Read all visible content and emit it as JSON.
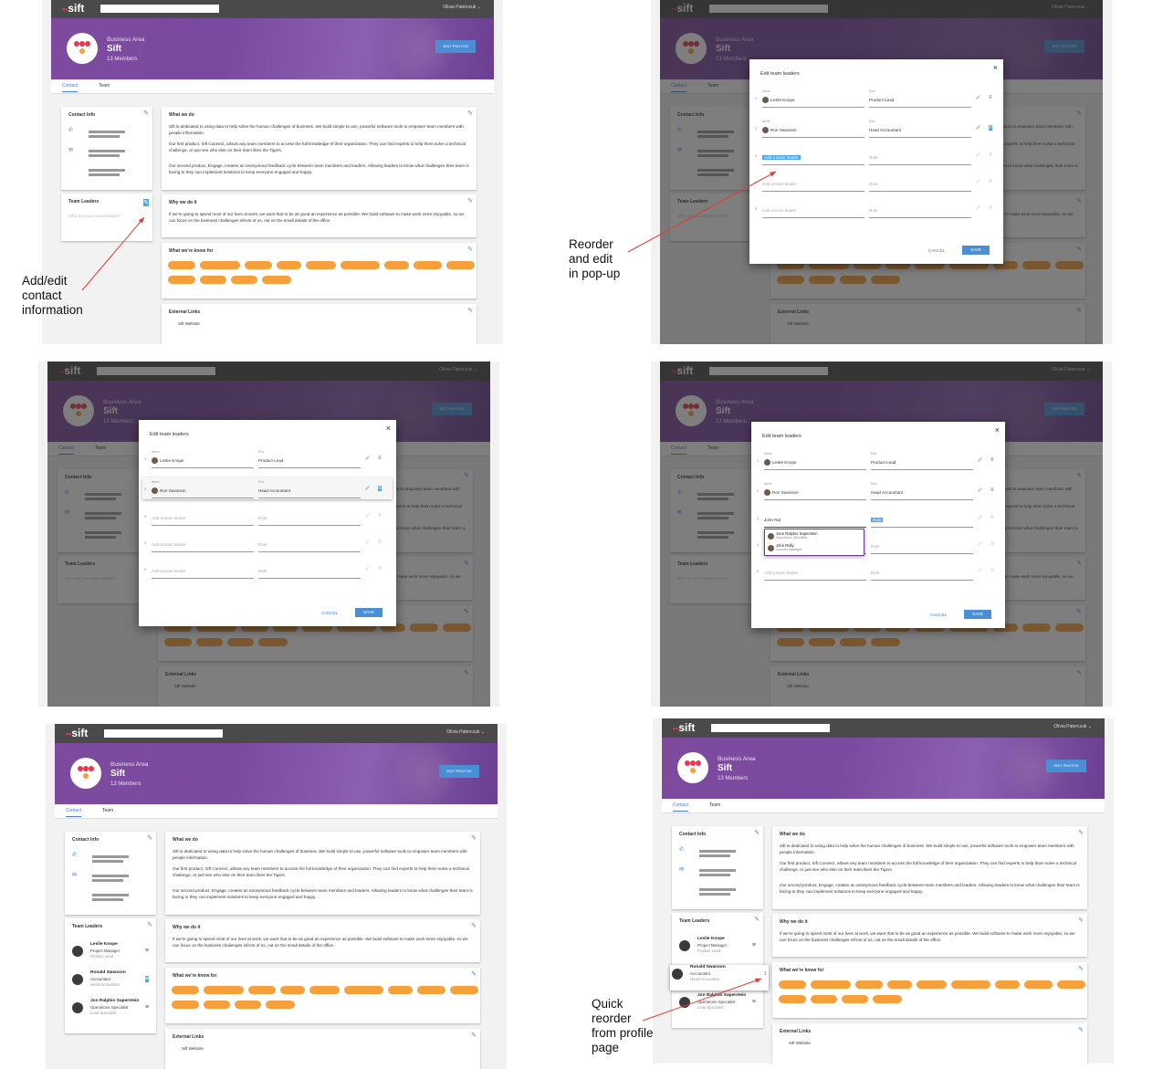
{
  "app": {
    "logo": "sift",
    "user_name": "Olivia Paterczuk",
    "business_area_label": "Business Area",
    "team_name": "Sift",
    "members": "13 Members",
    "edit_photos": "EDIT PHOTOS",
    "tabs": [
      "Contact",
      "Team"
    ]
  },
  "cards": {
    "contact_info": "Contact Info",
    "team_leaders": "Team Leaders",
    "team_leaders_placeholder": "Who are your team leaders?",
    "what_we_do": "What we do",
    "what_we_do_p1": "Sift is dedicated to using data to help solve the human challenges of business. We build simple to use, powerful software tools to empower team members with people information.",
    "what_we_do_p2": "Our first product, Sift Connect, allows any team members to access the full knowledge of their organization. They can find experts to help them solve a technical challenge, or just see who else on their team likes the Tigers.",
    "what_we_do_p3": "Our second product, Engage, creates an anonymous feedback cycle between team members and leaders. Allowing leaders to know what challenges their team is facing to they can implement solutions to keep everyone engaged and happy.",
    "why_we_do_it": "Why we do it",
    "why_we_do_it_text": "If we're going to spend most of our lives at work, we want that to be as good an experience as possible. We build software to make work more enjoyable, so we can focus on the business challenges infront of us, not on the small details of the office.",
    "known_for": "What we're know for",
    "external_links": "External Links",
    "sift_website": "Sift Website"
  },
  "modal": {
    "title": "Edit team leaders",
    "name_label": "Name",
    "role_label": "Role",
    "add_placeholder": "Add a team leader",
    "role_placeholder": "Role",
    "cancel": "CANCEL",
    "save": "SAVE",
    "leaders": [
      {
        "name": "Leslie Knope",
        "role": "Product Lead"
      },
      {
        "name": "Ron Swanson",
        "role": "Head Accountant"
      }
    ],
    "row_numbers": [
      "1",
      "2",
      "3",
      "4",
      "5"
    ],
    "typed": "John Ral",
    "suggestions": [
      {
        "name": "Jone Ralphio Saperstein",
        "role": "Operations Specialist"
      },
      {
        "name": "John Rally",
        "role": "Account Manager"
      }
    ]
  },
  "profile_leaders": [
    {
      "name": "Leslie Knope",
      "role": "Project Manager",
      "sub": "Product Lead"
    },
    {
      "name": "Ronald Swanson",
      "role": "Accountant",
      "sub": "Head Accountant"
    },
    {
      "name": "Jon Ralphio Saperstein",
      "role": "Operations Specialist",
      "sub": "Lead Specialist"
    }
  ],
  "annotations": {
    "add_edit": [
      "Add/edit",
      "contact",
      "information"
    ],
    "reorder": [
      "Reorder",
      "and edit",
      "in pop-up"
    ],
    "quick": [
      "Quick",
      "reorder",
      "from profile",
      "page"
    ]
  },
  "colors": {
    "accent": "#4a8fd4",
    "pill": "#f5a03a",
    "banner": "#7d4a9e",
    "topbar": "#4a4a4a",
    "arrow": "#e03c31"
  }
}
